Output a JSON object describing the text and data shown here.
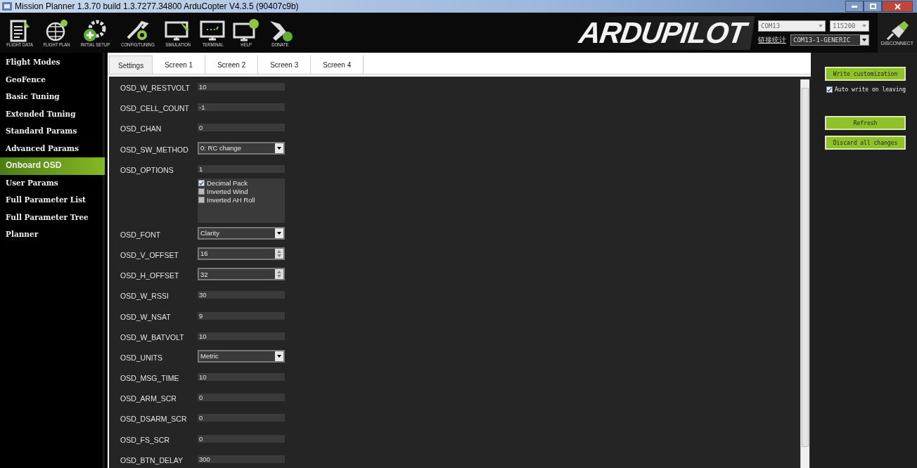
{
  "window": {
    "title": "Mission Planner 1.3.70 build 1.3.7277.34800 ArduCopter V4.3.5 (90407c9b)"
  },
  "toolbar": [
    {
      "label": "FLIGHT DATA",
      "kind": "data"
    },
    {
      "label": "FLIGHT PLAN",
      "kind": "plan"
    },
    {
      "label": "INITIAL SETUP",
      "kind": "setup"
    },
    {
      "label": "CONFIG/TUNING",
      "kind": "config"
    },
    {
      "label": "SIMULATION",
      "kind": "sim"
    },
    {
      "label": "TERMINAL",
      "kind": "terminal"
    },
    {
      "label": "HELP",
      "kind": "help"
    },
    {
      "label": "DONATE",
      "kind": "donate"
    }
  ],
  "logo": "ARDUPILOT",
  "connection": {
    "port": "COM13",
    "baud": "115200",
    "stats_link": "链接统计",
    "link": "COM13-1-GENERIC",
    "disconnect": "DISCONNECT"
  },
  "sidebar": {
    "items": [
      {
        "label": "Flight Modes",
        "selected": false
      },
      {
        "label": "GeoFence",
        "selected": false
      },
      {
        "label": "Basic Tuning",
        "selected": false
      },
      {
        "label": "Extended Tuning",
        "selected": false
      },
      {
        "label": "Standard Params",
        "selected": false
      },
      {
        "label": "Advanced Params",
        "selected": false
      },
      {
        "label": "Onboard OSD",
        "selected": true
      },
      {
        "label": "User Params",
        "selected": false
      },
      {
        "label": "Full Parameter List",
        "selected": false
      },
      {
        "label": "Full Parameter Tree",
        "selected": false
      },
      {
        "label": "Planner",
        "selected": false
      }
    ]
  },
  "tabs": [
    {
      "label": "Settings",
      "selected": true
    },
    {
      "label": "Screen 1",
      "selected": false
    },
    {
      "label": "Screen 2",
      "selected": false
    },
    {
      "label": "Screen 3",
      "selected": false
    },
    {
      "label": "Screen 4",
      "selected": false
    }
  ],
  "params": [
    {
      "name": "OSD_W_RESTVOLT",
      "kind": "text",
      "value": "10"
    },
    {
      "name": "OSD_CELL_COUNT",
      "kind": "text",
      "value": "-1"
    },
    {
      "name": "OSD_CHAN",
      "kind": "text",
      "value": "0"
    },
    {
      "name": "OSD_SW_METHOD",
      "kind": "combo",
      "value": "0: RC change"
    },
    {
      "name": "OSD_OPTIONS",
      "kind": "flags",
      "value": "1",
      "options": [
        {
          "label": "Decimal Pack",
          "checked": true
        },
        {
          "label": "Inverted Wind",
          "checked": false
        },
        {
          "label": "Inverted AH Roll",
          "checked": false
        }
      ]
    },
    {
      "name": "OSD_FONT",
      "kind": "combo",
      "value": "Clarity"
    },
    {
      "name": "OSD_V_OFFSET",
      "kind": "spin",
      "value": "16"
    },
    {
      "name": "OSD_H_OFFSET",
      "kind": "spin",
      "value": "32"
    },
    {
      "name": "OSD_W_RSSI",
      "kind": "text",
      "value": "30"
    },
    {
      "name": "OSD_W_NSAT",
      "kind": "text",
      "value": "9"
    },
    {
      "name": "OSD_W_BATVOLT",
      "kind": "text",
      "value": "10"
    },
    {
      "name": "OSD_UNITS",
      "kind": "combo",
      "value": "Metric"
    },
    {
      "name": "OSD_MSG_TIME",
      "kind": "text",
      "value": "10"
    },
    {
      "name": "OSD_ARM_SCR",
      "kind": "text",
      "value": "0"
    },
    {
      "name": "OSD_DSARM_SCR",
      "kind": "text",
      "value": "0"
    },
    {
      "name": "OSD_FS_SCR",
      "kind": "text",
      "value": "0"
    },
    {
      "name": "OSD_BTN_DELAY",
      "kind": "text",
      "value": "300"
    }
  ],
  "actions": {
    "write": "Write customization",
    "auto_write": {
      "label": "Auto write on leaving",
      "checked": true
    },
    "refresh": "Refresh",
    "discard": "Discard all changes"
  }
}
